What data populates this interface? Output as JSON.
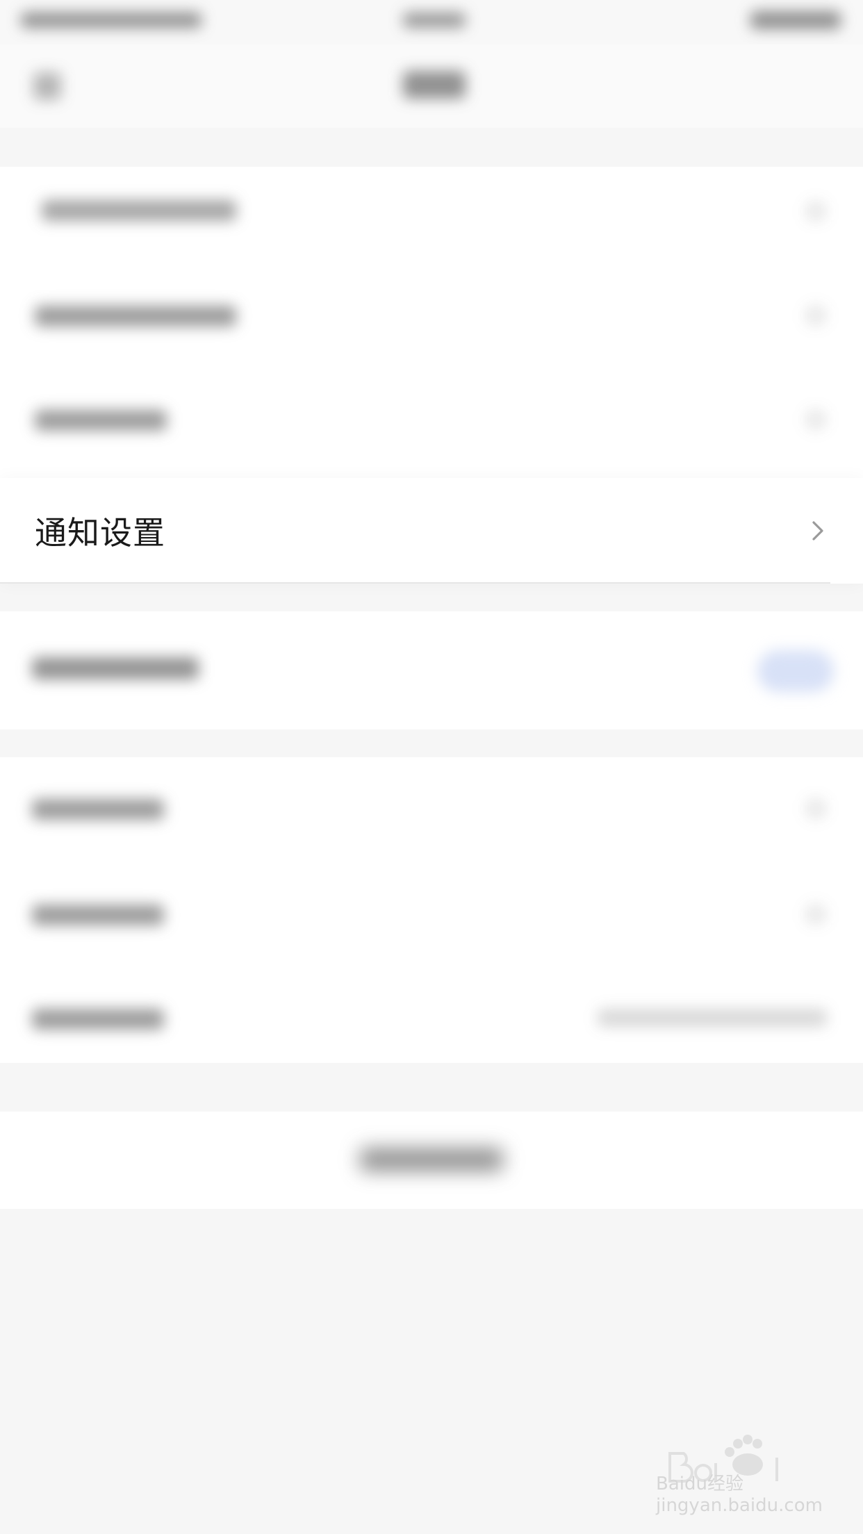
{
  "settings_list": {
    "focused_item": {
      "label": "通知设置"
    }
  },
  "watermark": {
    "text": "Baidu经验 jingyan.baidu.com"
  },
  "colors": {
    "background": "#f6f6f6",
    "row_background": "#ffffff",
    "label_text": "#1a1a1a",
    "chevron": "#9a9a9a"
  },
  "icons": {
    "chevron": "chevron-right-icon",
    "watermark_logo": "baidu-paw-icon"
  }
}
